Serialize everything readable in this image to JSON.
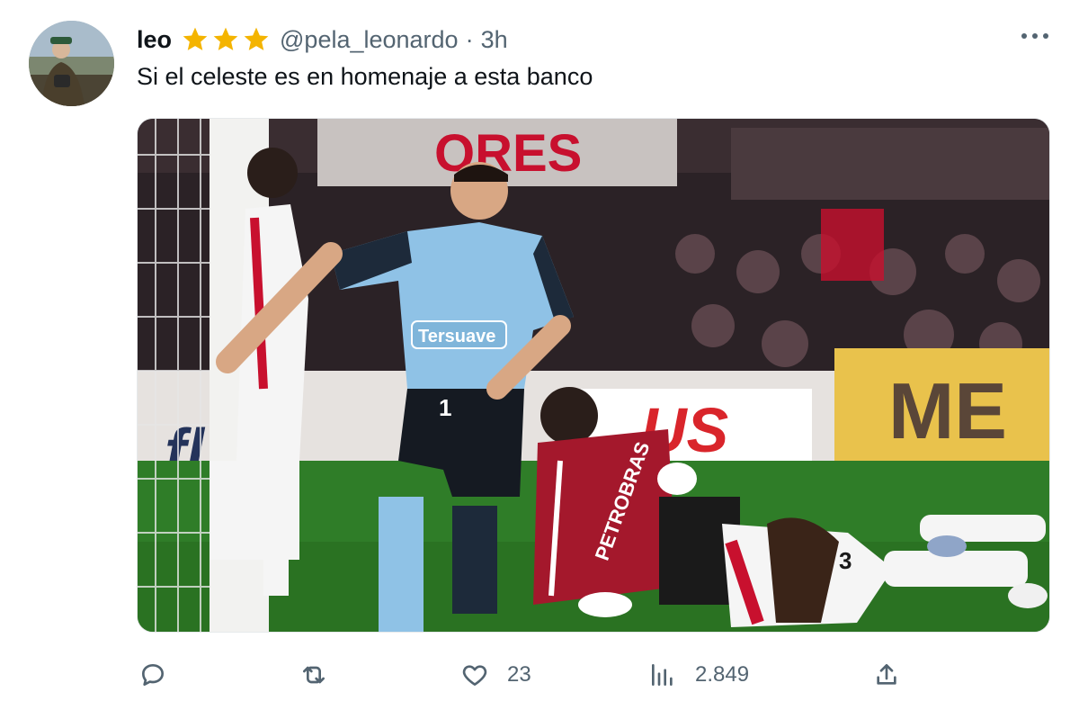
{
  "tweet": {
    "display_name": "leo",
    "handle": "@pela_leonardo",
    "separator": "·",
    "time": "3h",
    "text": "Si el celeste es en homenaje a esta banco",
    "badges": [
      "star-icon",
      "star-icon",
      "star-icon"
    ],
    "media": {
      "sign_top": "ORES",
      "sign_left": "fl ch",
      "sign_red": "US",
      "sign_yellow": "ME",
      "sponsor_shirt": "Tersuave",
      "player_number": "1",
      "opponent_sponsor": "PETROBRAS",
      "opponent_number": "3"
    },
    "actions": {
      "reply_count": "",
      "retweet_count": "",
      "like_count": "23",
      "views_count": "2.849"
    }
  },
  "colors": {
    "star": "#f4b400",
    "text_secondary": "#536471",
    "text_primary": "#0f1419",
    "belgrano_blue": "#8fc2e6",
    "river_red": "#c8102e",
    "pitch_green": "#2f7d28"
  }
}
